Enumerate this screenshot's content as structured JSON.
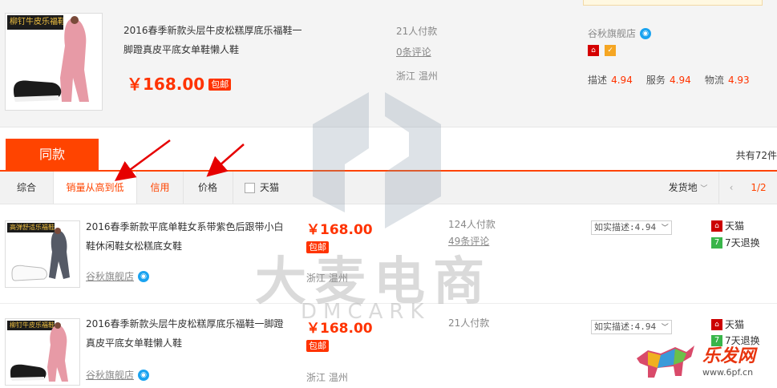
{
  "top_product": {
    "image_banner": "柳钉牛皮乐福鞋",
    "title_line1": "2016春季新款头层牛皮松糕厚底乐福鞋一",
    "title_line2": "脚蹬真皮平底女单鞋懒人鞋",
    "price": "￥168.00",
    "shipping": "包邮",
    "paid": "21人付款",
    "reviews": "0条评论",
    "location": "浙江 温州",
    "shop_name": "谷秋旗舰店",
    "ratings": [
      {
        "label": "描述",
        "value": "4.94"
      },
      {
        "label": "服务",
        "value": "4.94"
      },
      {
        "label": "物流",
        "value": "4.93"
      }
    ]
  },
  "tabs": {
    "active": "同款",
    "total": "共有72件"
  },
  "sort_bar": {
    "items": [
      "综合",
      "销量从高到低",
      "信用",
      "价格"
    ],
    "filter_tmall": "天猫",
    "ship_from": "发货地",
    "page": "1/2"
  },
  "list_items": [
    {
      "image_banner": "高弹舒适乐福鞋",
      "title_line1": "2016春季新款平底单鞋女系带紫色后跟带小白",
      "title_line2": "鞋休闲鞋女松糕底女鞋",
      "shop_name": "谷秋旗舰店",
      "price": "￥168.00",
      "shipping": "包邮",
      "location": "浙江 温州",
      "paid": "124人付款",
      "reviews": "49条评论",
      "desc_select": "如实描述:4.94",
      "tmall": "天猫",
      "return_policy": "7天退换"
    },
    {
      "image_banner": "柳钉牛皮乐福鞋",
      "title_line1": "2016春季新款头层牛皮松糕厚底乐福鞋一脚蹬",
      "title_line2": "真皮平底女单鞋懒人鞋",
      "shop_name": "谷秋旗舰店",
      "price": "￥168.00",
      "shipping": "包邮",
      "location": "浙江 温州",
      "paid": "21人付款",
      "desc_select": "如实描述:4.94",
      "tmall": "天猫",
      "return_policy": "7天退换"
    }
  ],
  "watermark": {
    "main": "大麦电商",
    "sub": "DMCARK"
  },
  "corner_logo": {
    "name": "乐发网",
    "url": "www.6pf.cn"
  },
  "colors": {
    "accent": "#ff4400",
    "price": "#ff3300",
    "tmall": "#cc0000",
    "return_green": "#39b54a"
  }
}
